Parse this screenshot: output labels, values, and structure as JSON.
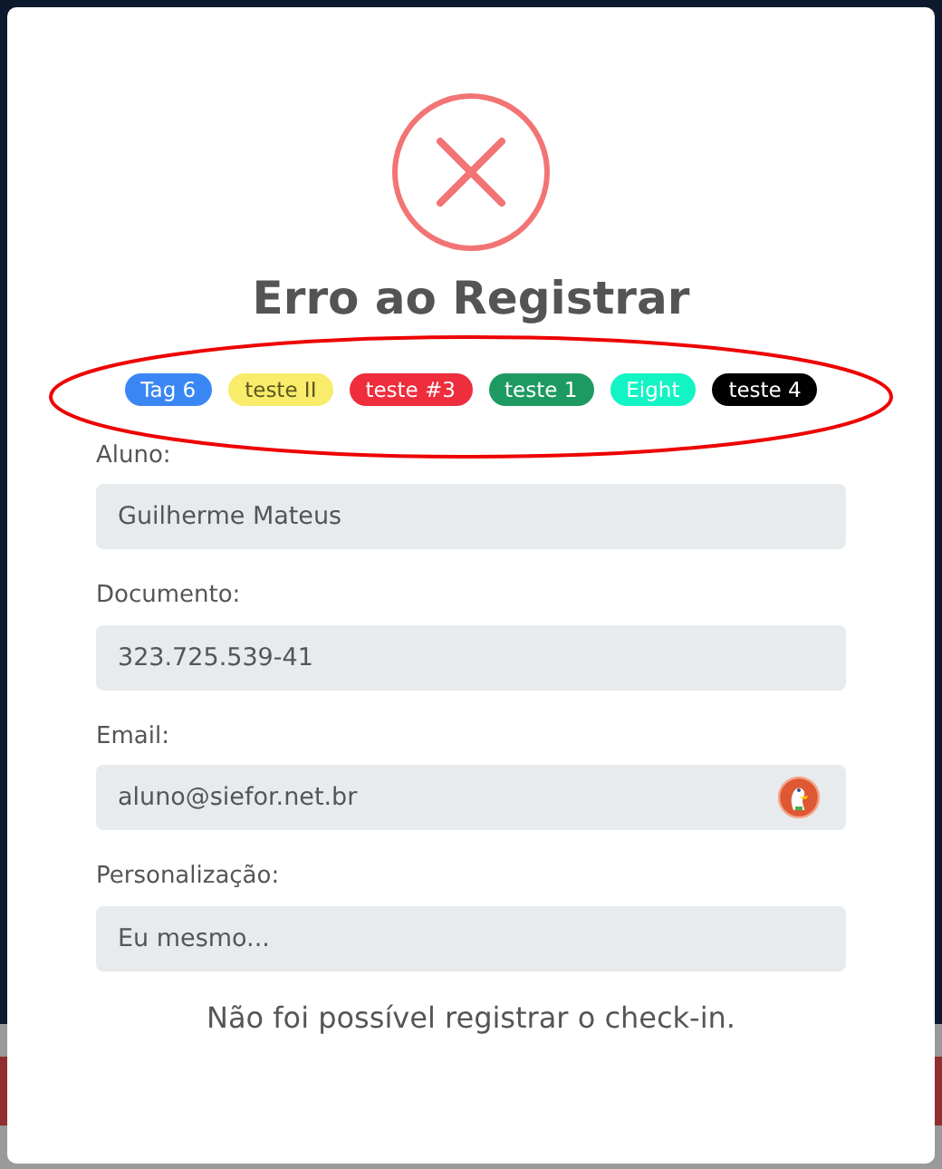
{
  "dialog": {
    "title": "Erro ao Registrar",
    "tags": [
      {
        "label": "Tag 6",
        "color": "#3a86f4"
      },
      {
        "label": "teste II",
        "color": "#f8ec6a"
      },
      {
        "label": "teste #3",
        "color": "#ee2d3d"
      },
      {
        "label": "teste 1",
        "color": "#1d9a62"
      },
      {
        "label": "Eight",
        "color": "#12f4c4"
      },
      {
        "label": "teste 4",
        "color": "#000000"
      }
    ],
    "fields": [
      {
        "label": "Aluno:",
        "value": "Guilherme Mateus"
      },
      {
        "label": "Documento:",
        "value": "323.725.539-41"
      },
      {
        "label": "Email:",
        "value": "aluno@siefor.net.br",
        "autofill_icon": true
      },
      {
        "label": "Personalização:",
        "value": "Eu mesmo..."
      }
    ],
    "message": "Não foi possível registrar o check-in."
  }
}
